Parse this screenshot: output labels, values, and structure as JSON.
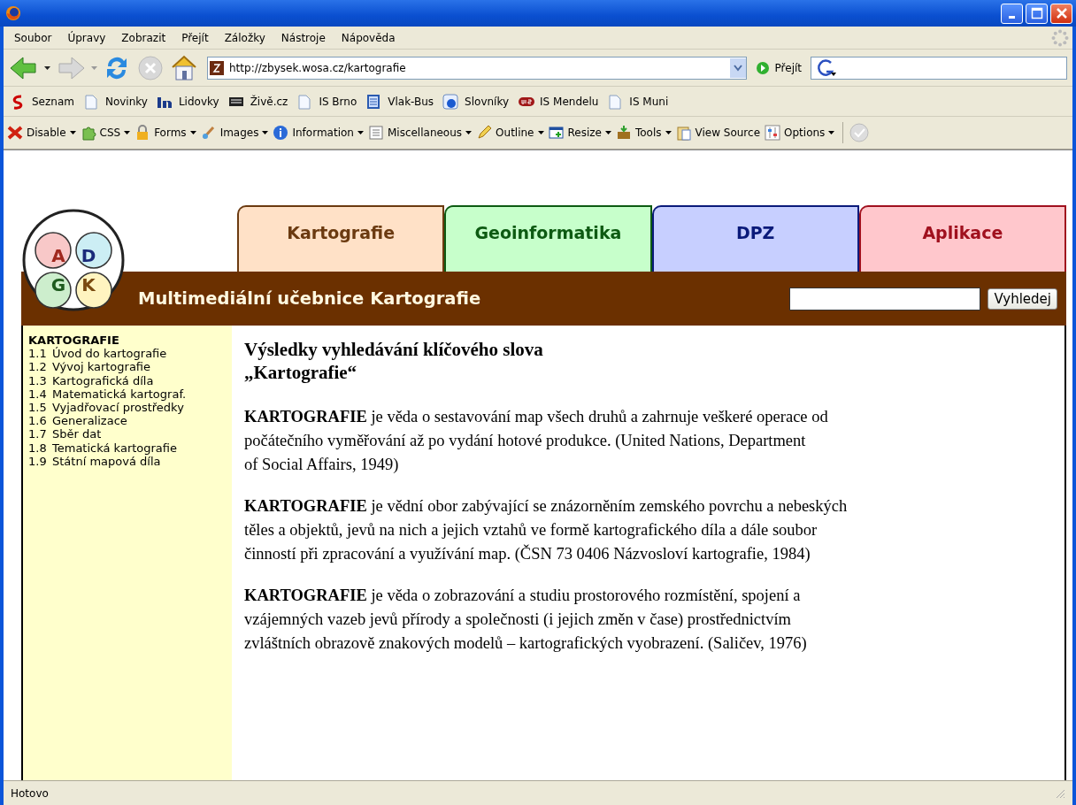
{
  "menu": [
    "Soubor",
    "Úpravy",
    "Zobrazit",
    "Přejít",
    "Záložky",
    "Nástroje",
    "Nápověda"
  ],
  "nav": {
    "url": "http://zbysek.wosa.cz/kartografie",
    "go_label": "Přejít"
  },
  "bookmarks": [
    {
      "label": "Seznam",
      "kind": "seznam"
    },
    {
      "label": "Novinky",
      "kind": "page"
    },
    {
      "label": "Lidovky",
      "kind": "lidovky"
    },
    {
      "label": "Živě.cz",
      "kind": "zive"
    },
    {
      "label": "IS Brno",
      "kind": "page"
    },
    {
      "label": "Vlak-Bus",
      "kind": "vlak"
    },
    {
      "label": "Slovníky",
      "kind": "slovniky"
    },
    {
      "label": "IS Mendelu",
      "kind": "mendelu"
    },
    {
      "label": "IS Muni",
      "kind": "page"
    }
  ],
  "devbar": [
    {
      "label": "Disable",
      "kind": "disable",
      "dropdown": true
    },
    {
      "label": "CSS",
      "kind": "css",
      "dropdown": true
    },
    {
      "label": "Forms",
      "kind": "forms",
      "dropdown": true
    },
    {
      "label": "Images",
      "kind": "images",
      "dropdown": true
    },
    {
      "label": "Information",
      "kind": "information",
      "dropdown": true
    },
    {
      "label": "Miscellaneous",
      "kind": "misc",
      "dropdown": true
    },
    {
      "label": "Outline",
      "kind": "outline",
      "dropdown": true
    },
    {
      "label": "Resize",
      "kind": "resize",
      "dropdown": true
    },
    {
      "label": "Tools",
      "kind": "tools",
      "dropdown": true
    },
    {
      "label": "View Source",
      "kind": "source",
      "dropdown": false
    },
    {
      "label": "Options",
      "kind": "options",
      "dropdown": true
    }
  ],
  "site": {
    "logo_letters": [
      {
        "letter": "A",
        "color": "#a0281e"
      },
      {
        "letter": "D",
        "color": "#1a2a7a"
      },
      {
        "letter": "G",
        "color": "#1e5a1e"
      },
      {
        "letter": "K",
        "color": "#7a4a10"
      }
    ],
    "tabs": [
      {
        "label": "Kartografie",
        "color": "#6b3a10"
      },
      {
        "label": "Geoinformatika",
        "color": "#0d5a12"
      },
      {
        "label": "DPZ",
        "color": "#0a1a7a"
      },
      {
        "label": "Aplikace",
        "color": "#a0101e"
      }
    ],
    "banner_title": "Multimediální učebnice Kartografie",
    "search_button": "Vyhledej",
    "sidebar": {
      "heading": "KARTOGRAFIE",
      "items": [
        {
          "number": "1.1",
          "label": "Úvod do kartografie"
        },
        {
          "number": "1.2",
          "label": "Vývoj kartografie"
        },
        {
          "number": "1.3",
          "label": "Kartografická díla"
        },
        {
          "number": "1.4",
          "label": "Matematická kartograf."
        },
        {
          "number": "1.5",
          "label": "Vyjadřovací prostředky"
        },
        {
          "number": "1.6",
          "label": "Generalizace"
        },
        {
          "number": "1.7",
          "label": "Sběr dat"
        },
        {
          "number": "1.8",
          "label": "Tematická kartografie"
        },
        {
          "number": "1.9",
          "label": "Státní mapová díla"
        }
      ]
    },
    "heading_lines": [
      "Výsledky vyhledávání klíčového slova",
      "„Kartografie“"
    ],
    "paragraphs": [
      {
        "lines": [
          "**KARTOGRAFIE** je věda o sestavování map všech druhů a zahrnuje veškeré operace od",
          "počátečního vyměřování až po vydání hotové produkce. (United Nations, Department",
          "of Social Affairs, 1949)"
        ]
      },
      {
        "lines": [
          "**KARTOGRAFIE** je vědní obor zabývající se znázorněním zemského povrchu a nebeských",
          "těles a objektů, jevů na nich a jejich vztahů ve formě kartografického díla a dále soubor",
          "činností při zpracování a využívání map. (ČSN 73 0406 Názvosloví kartografie, 1984)"
        ]
      },
      {
        "lines": [
          "**KARTOGRAFIE** je věda o zobrazování a studiu prostorového rozmístění, spojení a",
          "vzájemných vazeb jevů přírody a společnosti (i jejich změn v čase) prostřednictvím",
          "zvláštních obrazově znakových modelů – kartografických vyobrazení. (Saličev, 1976)"
        ]
      }
    ]
  },
  "status_bar": "Hotovo"
}
